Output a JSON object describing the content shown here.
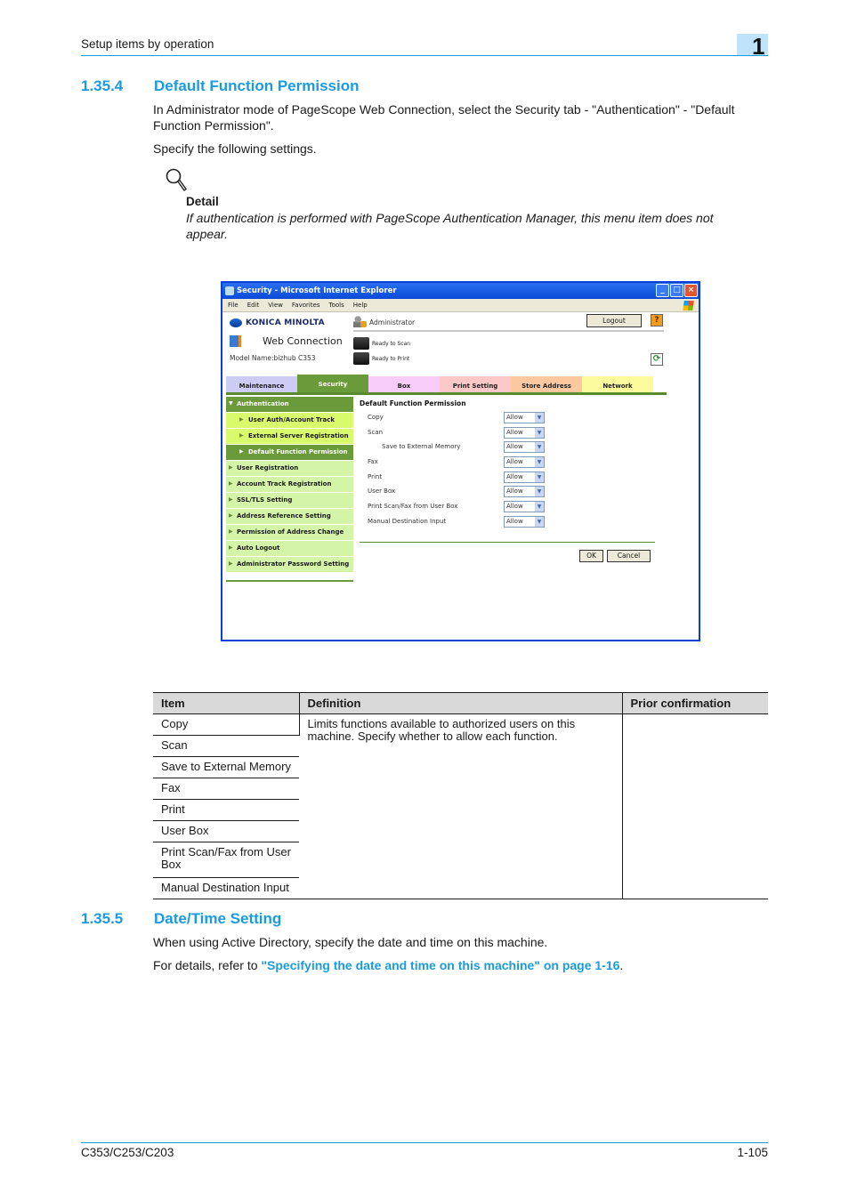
{
  "header": {
    "title": "Setup items by operation",
    "chapter": "1"
  },
  "section_1": {
    "number": "1.35.4",
    "title": "Default Function Permission",
    "intro": "In Administrator mode of PageScope Web Connection, select the Security tab - \"Authentication\" - \"Default Function Permission\".",
    "instruction": "Specify the following settings.",
    "detail": {
      "icon": "magnifier-icon",
      "label": "Detail",
      "text": "If authentication is performed with PageScope Authentication Manager, this menu item does not appear."
    }
  },
  "browser": {
    "window_title": "Security - Microsoft Internet Explorer",
    "window_buttons": {
      "minimize": "_",
      "maximize": "□",
      "close": "×"
    },
    "menu": [
      "File",
      "Edit",
      "View",
      "Favorites",
      "Tools",
      "Help"
    ],
    "brand": "KONICA MINOLTA",
    "product": "Web Connection",
    "model_name": "Model Name:bizhub C353",
    "user": "Administrator",
    "logout_label": "Logout",
    "help_label": "?",
    "refresh_label": "⟳",
    "scan_status": "Ready to Scan",
    "print_status": "Ready to Print",
    "tabs": [
      {
        "label": "Maintenance",
        "color": "#ccccf4"
      },
      {
        "label": "Security",
        "color": "#6a9a3a",
        "active": true
      },
      {
        "label": "Box",
        "color": "#f8ccf8"
      },
      {
        "label": "Print Setting",
        "color": "#fcc8c8"
      },
      {
        "label": "Store Address",
        "color": "#fcc8a0"
      },
      {
        "label": "Network",
        "color": "#fcfc9c"
      }
    ],
    "sidenav": [
      {
        "label": "Authentication",
        "type": "open"
      },
      {
        "label": "User Auth/Account Track",
        "type": "sub"
      },
      {
        "label": "External Server Registration",
        "type": "sub"
      },
      {
        "label": "Default Function Permission",
        "type": "selected"
      },
      {
        "label": "User Registration",
        "type": "level1"
      },
      {
        "label": "Account Track Registration",
        "type": "level1"
      },
      {
        "label": "SSL/TLS Setting",
        "type": "level1"
      },
      {
        "label": "Address Reference Setting",
        "type": "level1"
      },
      {
        "label": "Permission of Address Change",
        "type": "level1"
      },
      {
        "label": "Auto Logout",
        "type": "level1"
      },
      {
        "label": "Administrator Password Setting",
        "type": "level1"
      }
    ],
    "panel": {
      "title": "Default Function Permission",
      "rows": [
        {
          "label": "Copy",
          "value": "Allow"
        },
        {
          "label": "Scan",
          "value": "Allow"
        },
        {
          "label": "Save to External Memory",
          "value": "Allow",
          "indent": true
        },
        {
          "label": "Fax",
          "value": "Allow"
        },
        {
          "label": "Print",
          "value": "Allow"
        },
        {
          "label": "User Box",
          "value": "Allow"
        },
        {
          "label": "Print Scan/Fax from User Box",
          "value": "Allow"
        },
        {
          "label": "Manual Destination Input",
          "value": "Allow"
        }
      ],
      "ok_label": "OK",
      "cancel_label": "Cancel"
    }
  },
  "table": {
    "headers": [
      "Item",
      "Definition",
      "Prior confirmation"
    ],
    "items": [
      "Copy",
      "Scan",
      "Save to External Memory",
      "Fax",
      "Print",
      "User Box",
      "Print Scan/Fax from User Box",
      "Manual Destination Input"
    ],
    "definition": "Limits functions available to authorized users on this machine. Specify whether to allow each function.",
    "prior_confirmation": ""
  },
  "section_2": {
    "number": "1.35.5",
    "title": "Date/Time Setting",
    "text": "When using Active Directory, specify the date and time on this machine.",
    "ref_prefix": "For details, refer to ",
    "ref_link": "\"Specifying the date and time on this machine\" on page 1-16",
    "ref_suffix": "."
  },
  "footer": {
    "model": "C353/C253/C203",
    "page": "1-105"
  }
}
